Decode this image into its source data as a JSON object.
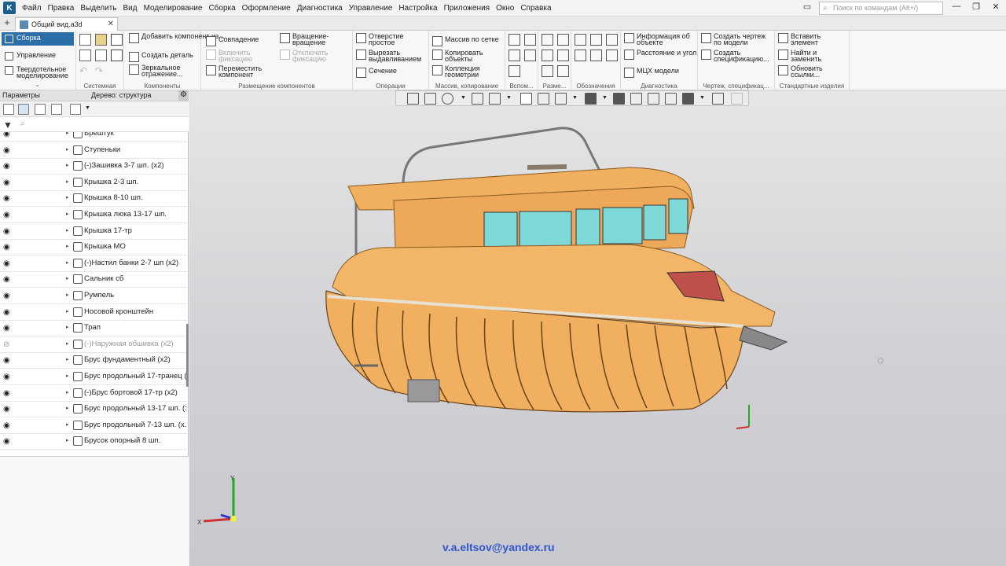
{
  "menu": {
    "items": [
      "Файл",
      "Правка",
      "Выделить",
      "Вид",
      "Моделирование",
      "Сборка",
      "Оформление",
      "Диагностика",
      "Управление",
      "Настройка",
      "Приложения",
      "Окно",
      "Справка"
    ],
    "search_placeholder": "Поиск по командам (Alt+/)"
  },
  "tabs": {
    "doc_title": "Общий вид.a3d"
  },
  "modes": [
    "Сборка",
    "Управление",
    "Твердотельное моделирование"
  ],
  "ribbon": {
    "groups": {
      "system": "Системная",
      "components": "Компоненты",
      "placement": "Размещение компонентов",
      "operations": "Операции",
      "array": "Массив, копирование",
      "aux": "Вспом...",
      "dims": "Разме...",
      "marks": "Обозначения",
      "diag": "Диагностика",
      "drawing": "Чертеж, спецификац...",
      "std": "Стандартные изделия"
    },
    "btns": {
      "add_component": "Добавить компонент из...",
      "create_part": "Создать деталь",
      "mirror": "Зеркальное отражение...",
      "coincide": "Совпадение",
      "rotate": "Вращение-вращение",
      "enable_fix": "Включить фиксацию",
      "disable_fix": "Отключить фиксацию",
      "move_comp": "Переместить компонент",
      "hole": "Отверстие простое",
      "cut_extrude": "Вырезать выдавливанием",
      "section": "Сечение",
      "grid_array": "Массив по сетке",
      "copy_obj": "Копировать объекты",
      "geom_coll": "Коллекция геометрии",
      "obj_info": "Информация об объекте",
      "dist_angle": "Расстояние и угол",
      "mcx": "МЦХ модели",
      "create_drawing": "Создать чертеж по модели",
      "create_spec": "Создать спецификацию...",
      "insert_elem": "Вставить элемент",
      "find_replace": "Найти и заменить",
      "update_links": "Обновить ссылки..."
    }
  },
  "sidebar": {
    "params_label": "Параметры",
    "tree_label": "Дерево: структура",
    "items": [
      {
        "label": "Брештук",
        "dim": false
      },
      {
        "label": "Ступеньки",
        "dim": false
      },
      {
        "label": "(-)Зашивка 3-7 шп. (x2)",
        "dim": false
      },
      {
        "label": "Крышка 2-3 шп.",
        "dim": false
      },
      {
        "label": "Крышка 8-10 шп.",
        "dim": false
      },
      {
        "label": "Крышка люка 13-17 шп.",
        "dim": false
      },
      {
        "label": "Крышка 17-тр",
        "dim": false
      },
      {
        "label": "Крышка МО",
        "dim": false
      },
      {
        "label": "(-)Настил банки 2-7 шп (x2)",
        "dim": false
      },
      {
        "label": "Сальник сб",
        "dim": false
      },
      {
        "label": "Румпель",
        "dim": false
      },
      {
        "label": "Носовой кронштейн",
        "dim": false
      },
      {
        "label": "Трап",
        "dim": false
      },
      {
        "label": "(-)Наружная обшивка (x2)",
        "dim": true
      },
      {
        "label": "Брус фундаментный (x2)",
        "dim": false
      },
      {
        "label": "Брус продольный 17-транец (",
        "dim": false
      },
      {
        "label": "(-)Брус бортовой 17-тр (x2)",
        "dim": false
      },
      {
        "label": "Брус продольный 13-17 шп. (:",
        "dim": false
      },
      {
        "label": "Брус продольный 7-13 шп. (x.",
        "dim": false
      },
      {
        "label": "Брусок опорный 8 шп.",
        "dim": false
      }
    ]
  },
  "viewport": {
    "email": "v.a.eltsov@yandex.ru"
  },
  "colors": {
    "accent": "#2c6ea7",
    "hull": "#f0b060",
    "glass": "#7fd8d8"
  }
}
